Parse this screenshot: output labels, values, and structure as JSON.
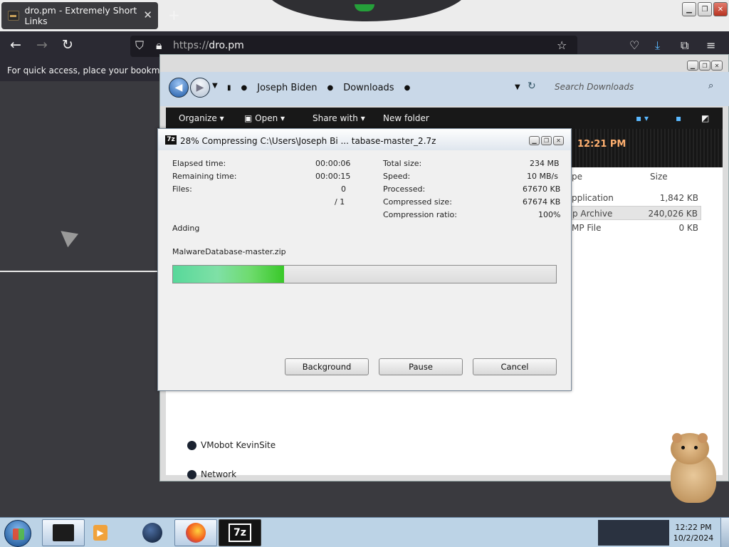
{
  "browser": {
    "tab_title": "dro.pm - Extremely Short Links",
    "tab_close": "✕",
    "new_tab": "+",
    "url_protocol": "https://",
    "url_host": "dro.pm",
    "bookmarks_hint": "For quick access, place your bookmarks h"
  },
  "explorer": {
    "breadcrumb": [
      "Joseph Biden",
      "Downloads"
    ],
    "search_placeholder": "Search Downloads",
    "toolbar": {
      "organize": "Organize",
      "open": "Open",
      "share": "Share with",
      "new_folder": "New folder"
    },
    "time_fragment": "12:21 PM",
    "column_type": "pe",
    "column_size": "Size",
    "files": [
      {
        "type": "pplication",
        "size": "1,842 KB"
      },
      {
        "type": "p Archive",
        "size": "240,026 KB"
      },
      {
        "type": "MP File",
        "size": "0 KB"
      }
    ],
    "tree": [
      {
        "label": "VMobot KevinSite"
      },
      {
        "label": "Network"
      }
    ]
  },
  "zip_dialog": {
    "icon_label": "7z",
    "title": "28% Compressing C:\\Users\\Joseph Bi ... tabase-master_2.7z",
    "elapsed_label": "Elapsed time:",
    "elapsed_value": "00:00:06",
    "remaining_label": "Remaining time:",
    "remaining_value": "00:00:15",
    "files_label": "Files:",
    "files_value": "0",
    "files_total": "/ 1",
    "total_size_label": "Total size:",
    "total_size_value": "234 MB",
    "speed_label": "Speed:",
    "speed_value": "10 MB/s",
    "processed_label": "Processed:",
    "processed_value": "67670 KB",
    "compressed_label": "Compressed size:",
    "compressed_value": "67674 KB",
    "ratio_label": "Compression ratio:",
    "ratio_value": "100%",
    "status": "Adding",
    "current_file": "MalwareDatabase-master.zip",
    "progress_percent": 29,
    "buttons": {
      "background": "Background",
      "pause": "Pause",
      "cancel": "Cancel"
    }
  },
  "taskbar": {
    "clock_time": "12:22 PM",
    "clock_date": "10/2/2024",
    "apps": [
      "terminal",
      "vlc-media-player",
      "browser-globe",
      "firefox",
      "7-zip"
    ]
  }
}
